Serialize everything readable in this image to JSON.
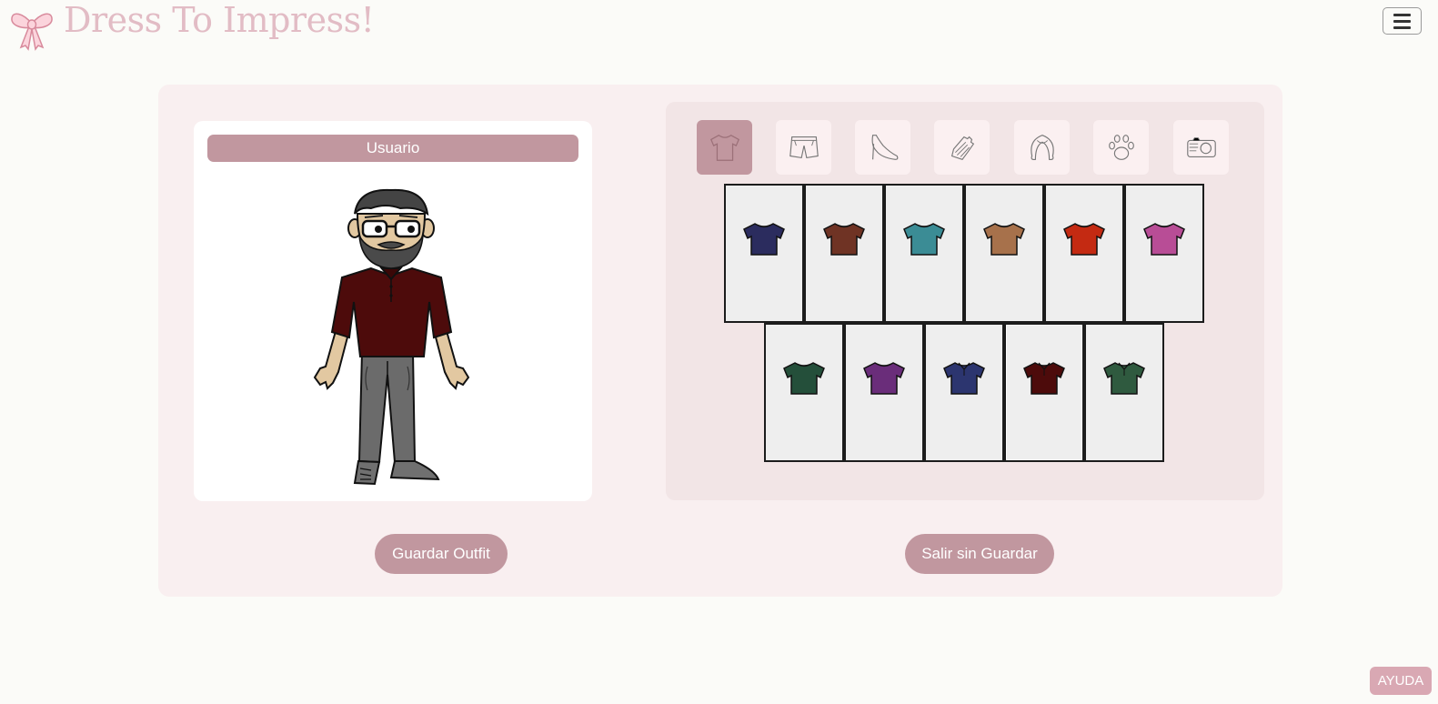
{
  "app": {
    "title": "Dress To Impress!",
    "logo_icon": "bow-icon",
    "menu_icon": "hamburger-icon"
  },
  "avatar_panel": {
    "user_label": "Usuario"
  },
  "categories": [
    {
      "name": "shirt",
      "icon": "tshirt-icon",
      "active": true
    },
    {
      "name": "pants",
      "icon": "shorts-icon",
      "active": false
    },
    {
      "name": "shoes",
      "icon": "high-heel-icon",
      "active": false
    },
    {
      "name": "accessories",
      "icon": "glove-icon",
      "active": false
    },
    {
      "name": "hair",
      "icon": "hair-icon",
      "active": false
    },
    {
      "name": "pets",
      "icon": "paw-icon",
      "active": false
    },
    {
      "name": "background",
      "icon": "camera-icon",
      "active": false
    }
  ],
  "items": [
    {
      "color": "#2b2c5e",
      "type": "tshirt",
      "selected": false
    },
    {
      "color": "#6f3324",
      "type": "tshirt",
      "selected": false
    },
    {
      "color": "#3b8c95",
      "type": "tshirt",
      "selected": false
    },
    {
      "color": "#a7714b",
      "type": "tshirt",
      "selected": false
    },
    {
      "color": "#c42a12",
      "type": "tshirt",
      "selected": false
    },
    {
      "color": "#b84d96",
      "type": "tshirt",
      "selected": false
    },
    {
      "color": "#244f3a",
      "type": "tshirt",
      "selected": false
    },
    {
      "color": "#6a2d7a",
      "type": "tshirt",
      "selected": false
    },
    {
      "color": "#2c356f",
      "type": "polo",
      "selected": false
    },
    {
      "color": "#4d0b0b",
      "type": "polo",
      "selected": true
    },
    {
      "color": "#2f5a3f",
      "type": "polo",
      "selected": false
    }
  ],
  "actions": {
    "save_label": "Guardar Outfit",
    "exit_label": "Salir sin Guardar"
  },
  "help": {
    "label": "AYUDA"
  },
  "colors": {
    "accent": "#c1979f",
    "card_bg": "#f9eff0",
    "wardrobe_bg": "#f2e5e6",
    "title": "#e2bcc5"
  }
}
